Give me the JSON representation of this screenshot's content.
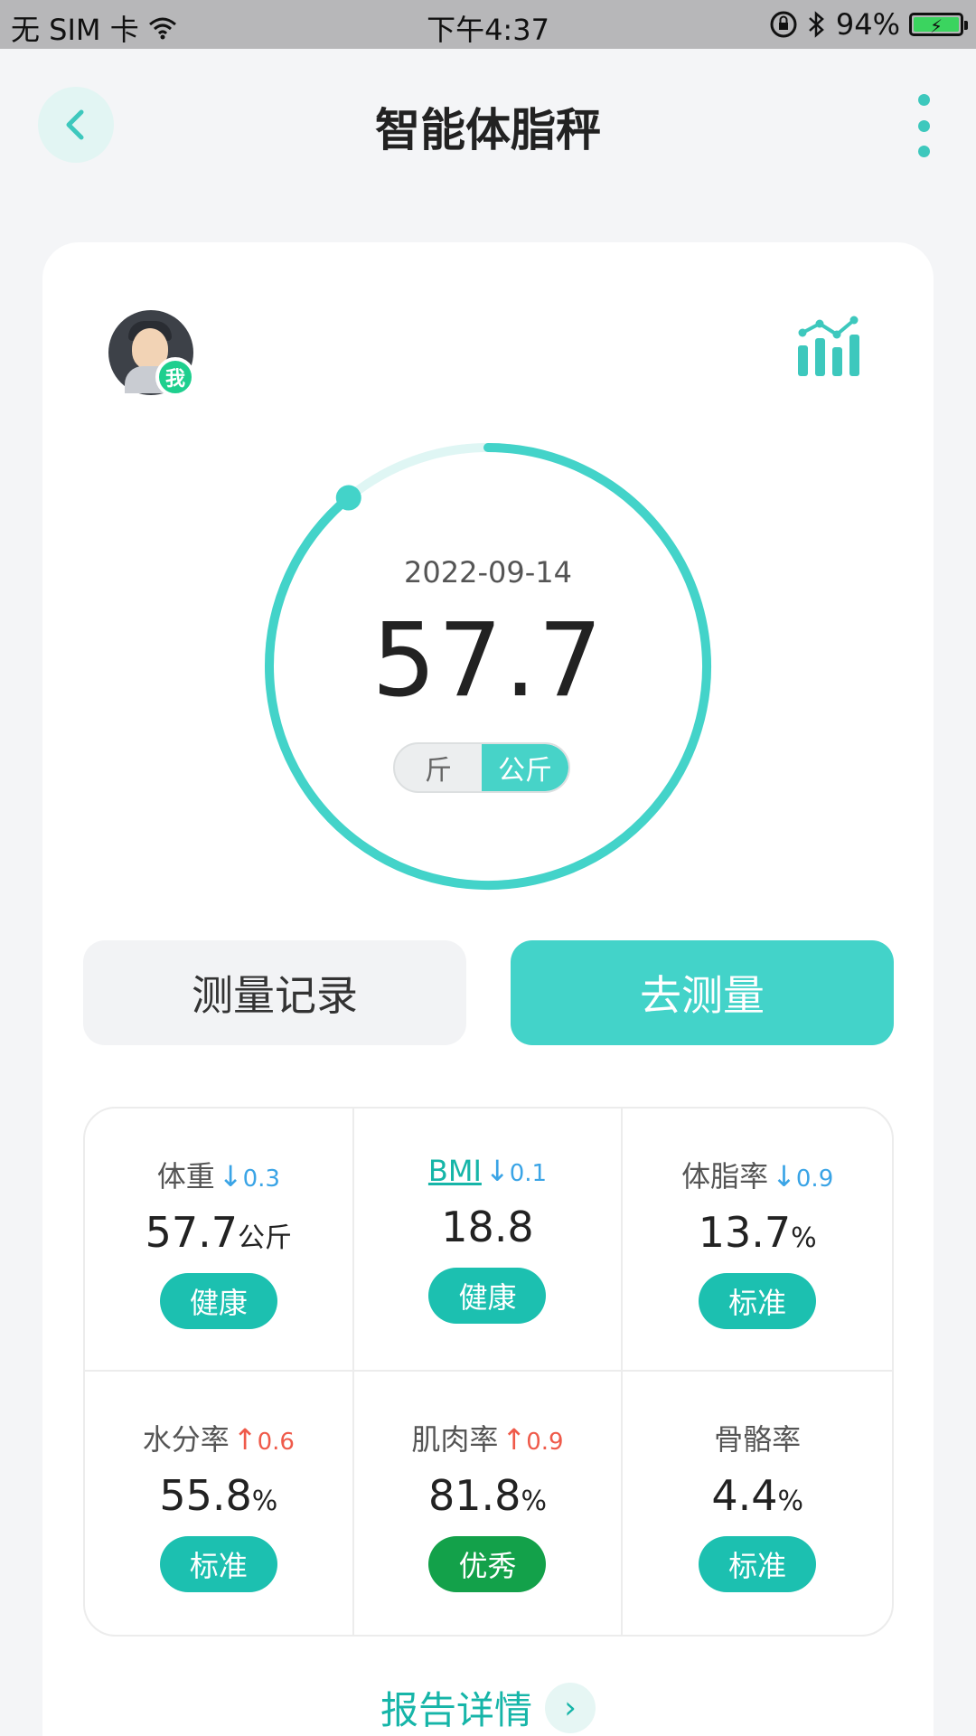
{
  "status_bar": {
    "carrier": "无 SIM 卡",
    "time": "下午4:37",
    "battery": "94%"
  },
  "nav": {
    "title": "智能体脂秤"
  },
  "profile": {
    "badge": "我"
  },
  "measurement": {
    "date": "2022-09-14",
    "value": "57.7",
    "progress_fraction": 0.89,
    "units": [
      "斤",
      "公斤"
    ],
    "active_unit": "公斤"
  },
  "buttons": {
    "record": "测量记录",
    "measure": "去测量"
  },
  "metrics": [
    {
      "label": "体重",
      "direction": "down",
      "arrow": "↓",
      "delta": "0.3",
      "value": "57.7",
      "unit": "公斤",
      "status": "健康",
      "status_color": "#1cc0b0"
    },
    {
      "label": "BMI",
      "direction": "down",
      "arrow": "↓",
      "delta": "0.1",
      "value": "18.8",
      "unit": "",
      "status": "健康",
      "status_color": "#1cc0b0"
    },
    {
      "label": "体脂率",
      "direction": "down",
      "arrow": "↓",
      "delta": "0.9",
      "value": "13.7",
      "unit": "%",
      "status": "标准",
      "status_color": "#1cc0b0"
    },
    {
      "label": "水分率",
      "direction": "up",
      "arrow": "↑",
      "delta": "0.6",
      "value": "55.8",
      "unit": "%",
      "status": "标准",
      "status_color": "#1cc0b0"
    },
    {
      "label": "肌肉率",
      "direction": "up",
      "arrow": "↑",
      "delta": "0.9",
      "value": "81.8",
      "unit": "%",
      "status": "优秀",
      "status_color": "#13a14a"
    },
    {
      "label": "骨骼率",
      "direction": "",
      "arrow": "",
      "delta": "",
      "value": "4.4",
      "unit": "%",
      "status": "标准",
      "status_color": "#1cc0b0"
    }
  ],
  "report": {
    "link": "报告详情",
    "chevron": "›"
  },
  "colors": {
    "accent": "#43d3c9",
    "ring_track": "#dff6f4",
    "down": "#3aa4e6",
    "up": "#ef5a4a"
  }
}
